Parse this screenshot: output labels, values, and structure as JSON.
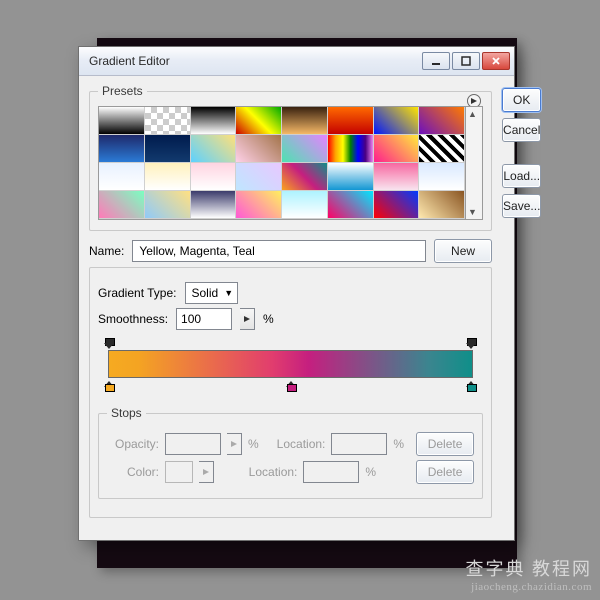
{
  "window": {
    "title": "Gradient Editor",
    "min_tip": "Minimize",
    "max_tip": "Maximize",
    "close_tip": "Close"
  },
  "buttons": {
    "ok": "OK",
    "cancel": "Cancel",
    "load": "Load...",
    "save": "Save...",
    "new": "New",
    "delete": "Delete"
  },
  "labels": {
    "presets": "Presets",
    "name": "Name:",
    "gradient_type": "Gradient Type:",
    "smoothness": "Smoothness:",
    "stops": "Stops",
    "opacity": "Opacity:",
    "location": "Location:",
    "color": "Color:",
    "percent": "%"
  },
  "values": {
    "name": "Yellow, Magenta, Teal",
    "gradient_type": "Solid",
    "smoothness": "100"
  },
  "gradient_stops": {
    "colors": [
      {
        "pos": 0,
        "hex": "#f6aa21"
      },
      {
        "pos": 50,
        "hex": "#c51f7f"
      },
      {
        "pos": 100,
        "hex": "#0f8f89"
      }
    ],
    "opacity": [
      {
        "pos": 0,
        "value": 100
      },
      {
        "pos": 100,
        "value": 100
      }
    ]
  },
  "preset_css": [
    "linear-gradient(#fff,#000)",
    "transparent",
    "linear-gradient(#000,#fff)",
    "linear-gradient(45deg,#c00,#ff0,#0a0)",
    "linear-gradient(#3a2210,#f5b867)",
    "linear-gradient(#ff6a00,#c40000)",
    "linear-gradient(45deg,#0016ff,#ffe400)",
    "linear-gradient(45deg,#6b0fbf,#ff7a00)",
    "linear-gradient(#1e2a6b,#2b7bd6)",
    "linear-gradient(#001b4d,#123a6e)",
    "linear-gradient(45deg,#5dd1ff,#ffe07a)",
    "linear-gradient(45deg,#ffd1e8,#a3744a)",
    "linear-gradient(45deg,#4de3b0,#e583ff)",
    "linear-gradient(to right,red,orange,yellow,green,blue,indigo,violet)",
    "linear-gradient(45deg,#ff1e8e,#ffeb3b)",
    "hatch",
    "linear-gradient(#e8f1ff,#ffffff)",
    "linear-gradient(#fff1bd,#ffffff)",
    "linear-gradient(#ffd4e1,#fff)",
    "linear-gradient(45deg,#bfe6ff,#e8c8ff)",
    "linear-gradient(45deg,#faa21e,#c51f7f,#0f8f89)",
    "linear-gradient(#fff,#1296d3)",
    "linear-gradient(#f768a1,#f8e4ef)",
    "linear-gradient(#d9e9ff,#fff)",
    "linear-gradient(45deg,#ff7ab8,#7affc1)",
    "linear-gradient(45deg,#90caf9,#ffe082)",
    "linear-gradient(#3b3b6b,#fff)",
    "linear-gradient(45deg,#ff59d6,#ffef5e)",
    "linear-gradient(#aef2ff,#fff)",
    "linear-gradient(45deg,#ff0066,#00e7ff)",
    "linear-gradient(45deg,#ff0004,#003bff)",
    "linear-gradient(45deg,#ffe9b0,#8a5523)"
  ],
  "watermark": {
    "line1": "查字典 教程网",
    "line2": "jiaocheng.chazidian.com"
  }
}
